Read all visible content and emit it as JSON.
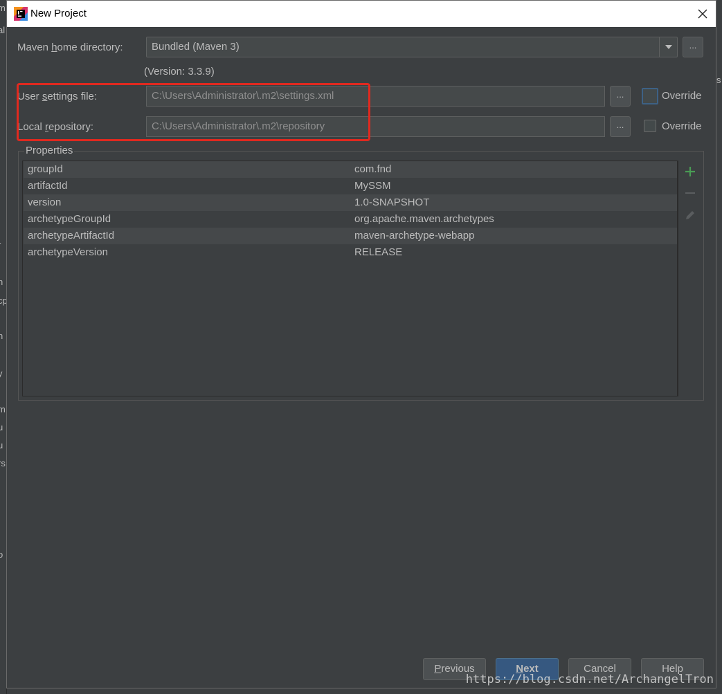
{
  "window": {
    "title": "New Project"
  },
  "maven": {
    "home_label_pre": "Maven ",
    "home_label_mn": "h",
    "home_label_post": "ome directory:",
    "home_value": "Bundled (Maven 3)",
    "version": "(Version: 3.3.9)"
  },
  "user_settings": {
    "label_pre": "User ",
    "label_mn": "s",
    "label_post": "ettings file:",
    "value": "C:\\Users\\Administrator\\.m2\\settings.xml",
    "override_label": "Override",
    "override_checked": false
  },
  "local_repo": {
    "label_pre": "Local ",
    "label_mn": "r",
    "label_post": "epository:",
    "value": "C:\\Users\\Administrator\\.m2\\repository",
    "override_label": "Override",
    "override_checked": false
  },
  "browse_label": "...",
  "properties": {
    "title": "Properties",
    "rows": [
      {
        "key": "groupId",
        "value": "com.fnd"
      },
      {
        "key": "artifactId",
        "value": "MySSM"
      },
      {
        "key": "version",
        "value": "1.0-SNAPSHOT"
      },
      {
        "key": "archetypeGroupId",
        "value": "org.apache.maven.archetypes"
      },
      {
        "key": "archetypeArtifactId",
        "value": "maven-archetype-webapp"
      },
      {
        "key": "archetypeVersion",
        "value": "RELEASE"
      }
    ],
    "toolbar": [
      "add-icon",
      "remove-icon",
      "edit-icon"
    ]
  },
  "buttons": {
    "previous_mn": "P",
    "previous_rest": "revious",
    "next_mn": "N",
    "next_rest": "ext",
    "cancel": "Cancel",
    "help": "Help"
  },
  "background_fragments": [
    "m",
    "al",
    "r",
    "n",
    "cp",
    "n",
    "y",
    "m",
    "u",
    "u",
    "rs",
    "o"
  ],
  "background_right_fragment": "s",
  "watermark": "https://blog.csdn.net/ArchangelTron",
  "colors": {
    "highlight": "#e0291f",
    "accent": "#365880",
    "add": "#499c54"
  }
}
